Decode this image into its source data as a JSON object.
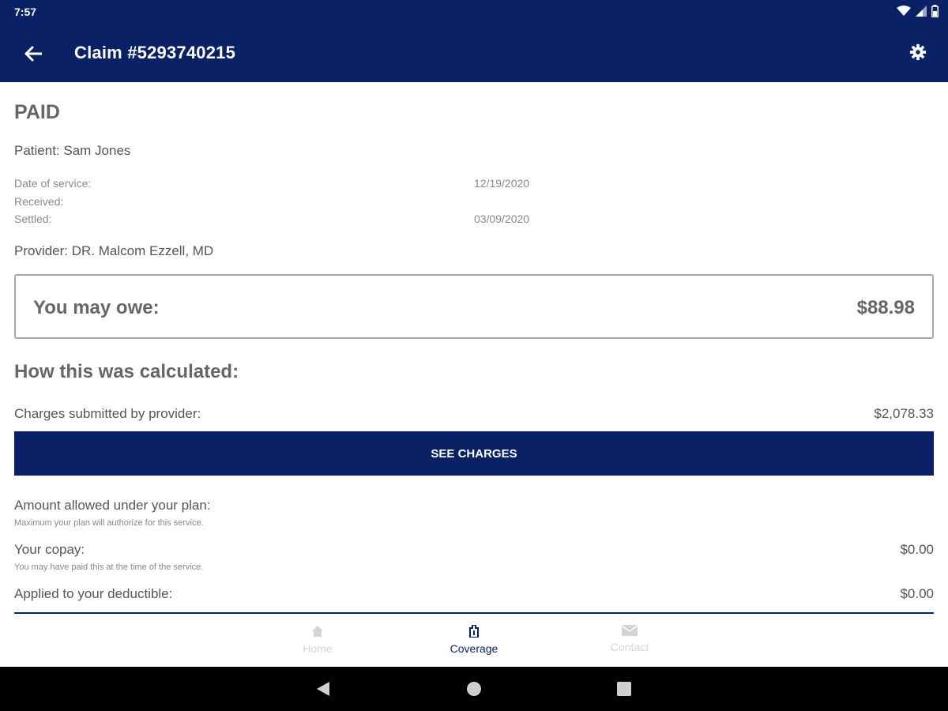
{
  "status_bar": {
    "time": "7:57"
  },
  "app_bar": {
    "title": "Claim #5293740215"
  },
  "claim": {
    "status": "PAID",
    "patient": "Patient: Sam Jones",
    "dates": [
      {
        "label": "Date of service:",
        "value": "12/19/2020"
      },
      {
        "label": "Received:",
        "value": ""
      },
      {
        "label": "Settled:",
        "value": "03/09/2020"
      }
    ],
    "provider": "Provider: DR. Malcom Ezzell, MD"
  },
  "owe": {
    "label": "You may owe:",
    "value": "$88.98"
  },
  "calculation": {
    "heading": "How this was calculated:",
    "charges_label": "Charges submitted by provider:",
    "charges_value": "$2,078.33",
    "see_charges_label": "SEE CHARGES",
    "allowed_label": "Amount allowed under your plan:",
    "allowed_sub": "Maximum your plan will authorize for this service.",
    "copay_label": "Your copay:",
    "copay_sub": "You may have paid this at the time of the service.",
    "copay_value": "$0.00",
    "deductible_label": "Applied to your deductible:",
    "deductible_value": "$0.00"
  },
  "bottom_nav": {
    "items": [
      {
        "label": "Home",
        "icon": "home-icon",
        "active": false
      },
      {
        "label": "Coverage",
        "icon": "coverage-icon",
        "active": true
      },
      {
        "label": "Contact",
        "icon": "mail-icon",
        "active": false
      }
    ]
  },
  "colors": {
    "primary": "#0b2166",
    "text": "#555555",
    "muted": "#888888",
    "inactive": "#d4d4d4"
  }
}
